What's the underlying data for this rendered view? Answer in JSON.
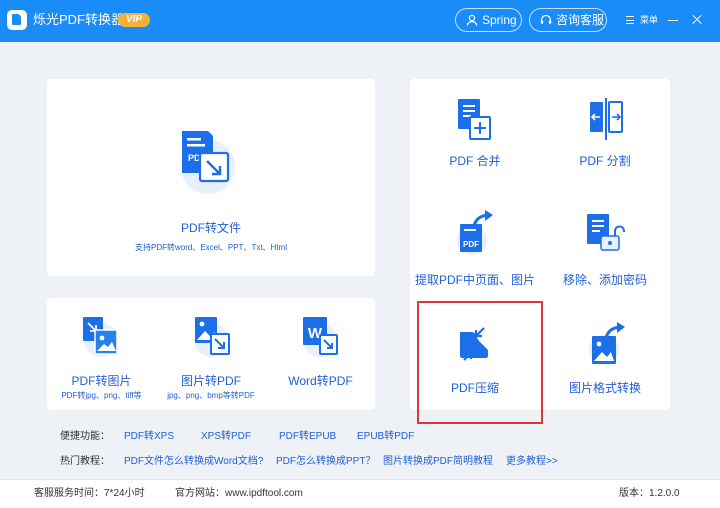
{
  "app": {
    "title": "烁光PDF转换器",
    "vip_badge": "VIP"
  },
  "header": {
    "user_name": "Spring",
    "service_label": "咨询客服",
    "menu_label": "菜单"
  },
  "feature_main": {
    "label": "PDF转文件",
    "sub": "支持PDF转word、Excel、PPT、Txt、Html"
  },
  "feature_bottom": [
    {
      "label": "PDF转图片",
      "sub": "PDF转jpg、png、tiff等"
    },
    {
      "label": "图片转PDF",
      "sub": "jpg、png、bmp等转PDF"
    },
    {
      "label": "Word转PDF",
      "sub": ""
    }
  ],
  "tools": [
    {
      "label": "PDF 合并"
    },
    {
      "label": "PDF 分割"
    },
    {
      "label": "提取PDF中页面、图片"
    },
    {
      "label": "移除、添加密码"
    },
    {
      "label": "PDF压缩"
    },
    {
      "label": "图片格式转换"
    }
  ],
  "quick": {
    "label": "便捷功能：",
    "items": [
      "PDF转XPS",
      "XPS转PDF",
      "PDF转EPUB",
      "EPUB转PDF"
    ]
  },
  "tutorials": {
    "label": "热门教程：",
    "items": [
      "PDF文件怎么转换成Word文档?",
      "PDF怎么转换成PPT？",
      "图片转换成PDF简明教程",
      "更多教程>>"
    ]
  },
  "status": {
    "service_time": "客服服务时间：7*24小时",
    "website": "官方网站：www.ipdftool.com",
    "version": "版本：1.2.0.0"
  },
  "colors": {
    "accent": "#1a8cf8",
    "link": "#1f5fd6",
    "highlight": "#e03535"
  },
  "icons": [
    "pdf-convert-icon",
    "pdf-to-image-icon",
    "image-to-pdf-icon",
    "word-to-pdf-icon",
    "pdf-merge-icon",
    "pdf-split-icon",
    "pdf-extract-icon",
    "pdf-password-icon",
    "pdf-compress-icon",
    "image-format-icon"
  ]
}
